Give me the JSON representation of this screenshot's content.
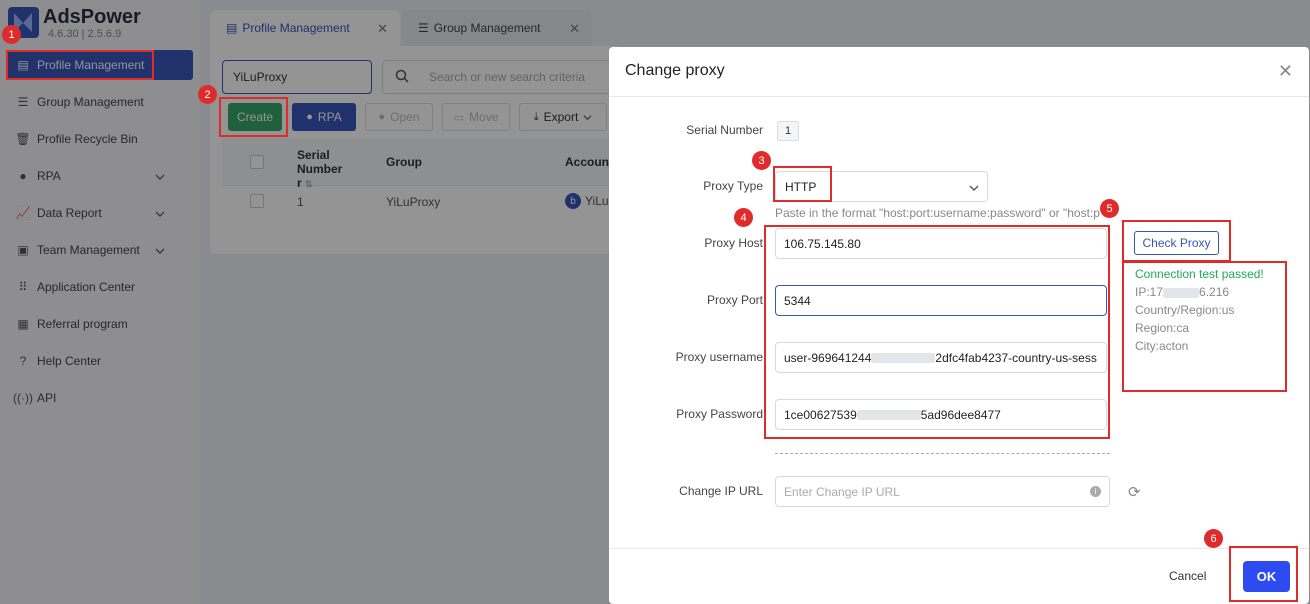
{
  "app": {
    "name": "AdsPower",
    "version": "4.6.30 | 2.5.6.9"
  },
  "sidebar": {
    "items": [
      {
        "label": "Profile Management",
        "icon": "profile-icon"
      },
      {
        "label": "Group Management",
        "icon": "group-icon"
      },
      {
        "label": "Profile Recycle Bin",
        "icon": "trash-icon"
      },
      {
        "label": "RPA",
        "icon": "rpa-icon"
      },
      {
        "label": "Data Report",
        "icon": "chart-icon"
      },
      {
        "label": "Team Management",
        "icon": "team-icon"
      },
      {
        "label": "Application Center",
        "icon": "apps-icon"
      },
      {
        "label": "Referral program",
        "icon": "gift-icon"
      },
      {
        "label": "Help Center",
        "icon": "help-icon"
      },
      {
        "label": "API",
        "icon": "api-icon"
      }
    ]
  },
  "tabs": [
    {
      "label": "Profile Management",
      "active": true
    },
    {
      "label": "Group Management",
      "active": false
    }
  ],
  "toolbar": {
    "group_value": "YiLuProxy",
    "search_placeholder": "Search or new search criteria",
    "create": "Create",
    "rpa": "RPA",
    "open": "Open",
    "move": "Move",
    "export": "Export"
  },
  "table": {
    "columns": [
      "Serial Number",
      "Group",
      "Account"
    ],
    "serial_sort_suffix": "r",
    "rows": [
      {
        "serial": "1",
        "group": "YiLuProxy",
        "account": "YiLu"
      }
    ]
  },
  "modal": {
    "title": "Change proxy",
    "serial_label": "Serial Number",
    "serial_value": "1",
    "proxy_type_label": "Proxy Type",
    "proxy_type_value": "HTTP",
    "hint": "Paste in the format \"host:port:username:password\" or \"host:p",
    "host_label": "Proxy Host",
    "host_value": "106.75.145.80",
    "port_label": "Proxy Port",
    "port_value": "5344",
    "user_label": "Proxy username",
    "user_prefix": "user-969641244",
    "user_suffix": "2dfc4fab4237-country-us-sess",
    "pass_label": "Proxy Password",
    "pass_prefix": "1ce00627539",
    "pass_suffix": "5ad96dee8477",
    "ipurl_label": "Change IP URL",
    "ipurl_placeholder": "Enter Change IP URL",
    "check_button": "Check Proxy",
    "result_ok": "Connection test passed!",
    "result_ip_prefix": "IP:17",
    "result_ip_suffix": "6.216",
    "result_country": "Country/Region:us",
    "result_region": "Region:ca",
    "result_city": "City:acton",
    "cancel": "Cancel",
    "ok": "OK"
  },
  "annotations": [
    "1",
    "2",
    "3",
    "4",
    "5",
    "6"
  ],
  "colors": {
    "brand": "#3a55b8",
    "create": "#3aa66a",
    "highlight": "#e02b2b",
    "ok_button": "#2d4bf0",
    "success": "#22a85a"
  }
}
